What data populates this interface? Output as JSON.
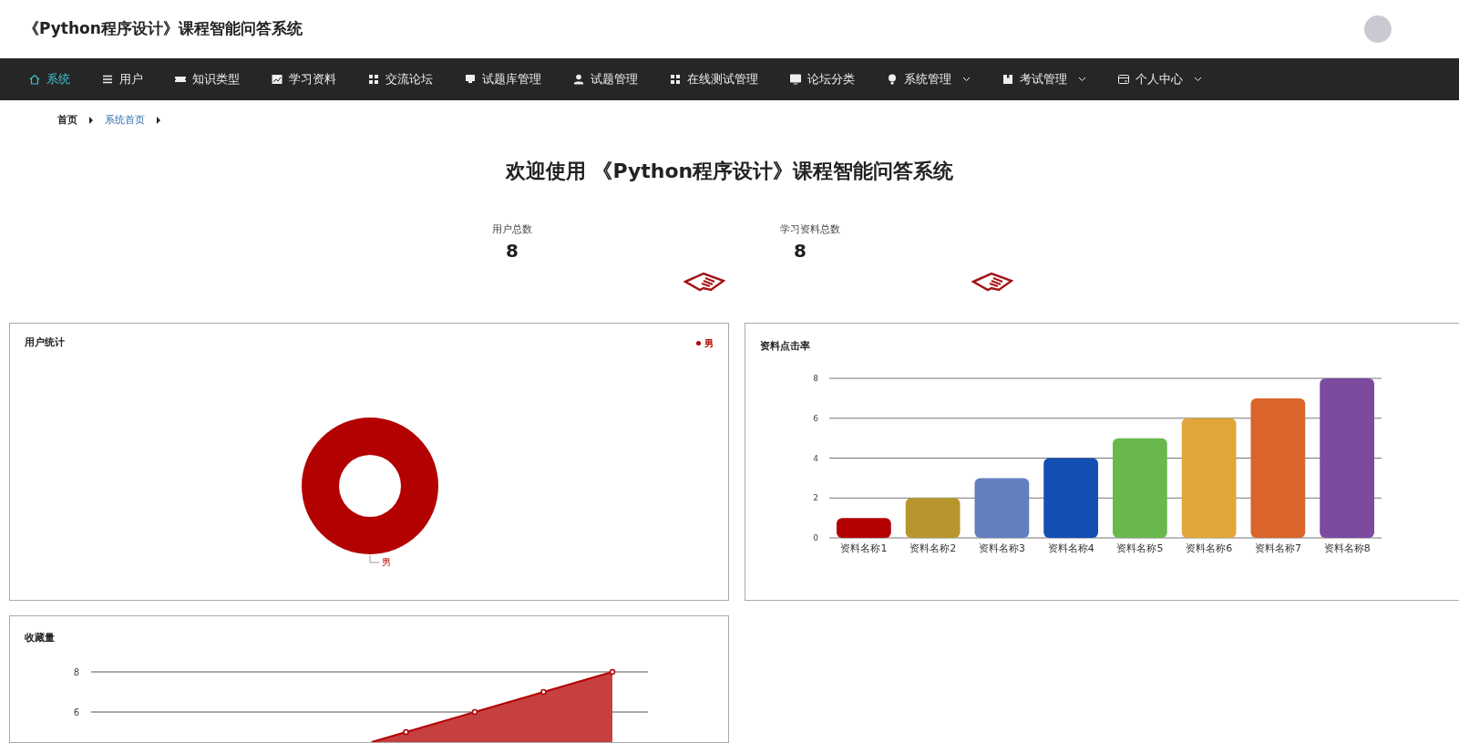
{
  "header": {
    "title": "《Python程序设计》课程智能问答系统"
  },
  "nav": [
    {
      "label": "系统",
      "selected": true,
      "dropdown": false
    },
    {
      "label": "用户",
      "selected": false,
      "dropdown": false
    },
    {
      "label": "知识类型",
      "selected": false,
      "dropdown": false
    },
    {
      "label": "学习资料",
      "selected": false,
      "dropdown": false
    },
    {
      "label": "交流论坛",
      "selected": false,
      "dropdown": false
    },
    {
      "label": "试题库管理",
      "selected": false,
      "dropdown": false
    },
    {
      "label": "试题管理",
      "selected": false,
      "dropdown": false
    },
    {
      "label": "在线测试管理",
      "selected": false,
      "dropdown": false
    },
    {
      "label": "论坛分类",
      "selected": false,
      "dropdown": false
    },
    {
      "label": "系统管理",
      "selected": false,
      "dropdown": true
    },
    {
      "label": "考试管理",
      "selected": false,
      "dropdown": true
    },
    {
      "label": "个人中心",
      "selected": false,
      "dropdown": true
    }
  ],
  "breadcrumb": [
    {
      "label": "首页",
      "current": false
    },
    {
      "label": "系统首页",
      "current": true
    }
  ],
  "welcome": "欢迎使用 《Python程序设计》课程智能问答系统",
  "stats": [
    {
      "label": "用户总数",
      "value": "8"
    },
    {
      "label": "学习资料总数",
      "value": "8"
    }
  ],
  "user_stats": {
    "title": "用户统计",
    "legend": "男",
    "slice_label": "男",
    "color": "#b30000"
  },
  "click_rate": {
    "title": "资料点击率",
    "chart_data": {
      "type": "bar",
      "categories": [
        "资料名称1",
        "资料名称2",
        "资料名称3",
        "资料名称4",
        "资料名称5",
        "资料名称6",
        "资料名称7",
        "资料名称8"
      ],
      "values": [
        1,
        2,
        3,
        4,
        5,
        6,
        7,
        8
      ],
      "ylim": [
        0,
        8
      ],
      "yticks": [
        0,
        2,
        4,
        6,
        8
      ],
      "grid": true
    }
  },
  "favorites": {
    "title": "收藏量",
    "axis_labels": [
      "8",
      "6"
    ]
  }
}
